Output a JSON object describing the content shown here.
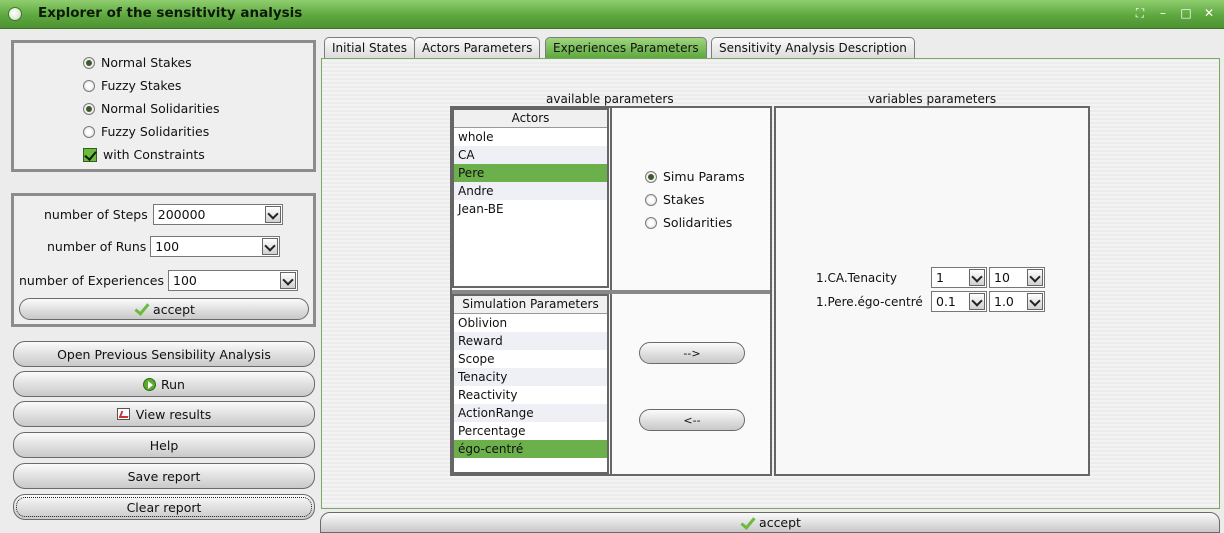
{
  "window": {
    "title": "Explorer of the sensitivity analysis",
    "controls": [
      "⛶",
      "–",
      "□",
      "✕"
    ]
  },
  "options": {
    "radios": [
      {
        "label": "Normal Stakes",
        "selected": true
      },
      {
        "label": "Fuzzy Stakes",
        "selected": false
      },
      {
        "label": "Normal Solidarities",
        "selected": true
      },
      {
        "label": "Fuzzy Solidarities",
        "selected": false
      }
    ],
    "constraints_label": "with Constraints"
  },
  "settings": {
    "steps_label": "number of Steps",
    "steps_value": "200000",
    "runs_label": "number of Runs",
    "runs_value": "100",
    "experiences_label": "number of Experiences",
    "experiences_value": "100",
    "accept_label": "accept"
  },
  "actions": {
    "open_previous": "Open Previous Sensibility Analysis",
    "run": "Run",
    "view_results": "View results",
    "help": "Help",
    "save_report": "Save report",
    "clear_report": "Clear report"
  },
  "tabs": [
    {
      "label": "Initial States",
      "active": false
    },
    {
      "label": "Actors Parameters",
      "active": false
    },
    {
      "label": "Experiences Parameters",
      "active": true
    },
    {
      "label": "Sensitivity Analysis Description",
      "active": false
    }
  ],
  "experiences": {
    "available_title": "available parameters",
    "variables_title": "variables parameters",
    "actors_header": "Actors",
    "actors": [
      {
        "label": "whole",
        "selected": false
      },
      {
        "label": "CA",
        "selected": false
      },
      {
        "label": "Pere",
        "selected": true
      },
      {
        "label": "Andre",
        "selected": false
      },
      {
        "label": "Jean-BE",
        "selected": false
      }
    ],
    "param_types": [
      {
        "label": "Simu Params",
        "selected": true
      },
      {
        "label": "Stakes",
        "selected": false
      },
      {
        "label": "Solidarities",
        "selected": false
      }
    ],
    "sim_header": "Simulation Parameters",
    "sim_params": [
      {
        "label": "Oblivion",
        "selected": false
      },
      {
        "label": "Reward",
        "selected": false
      },
      {
        "label": "Scope",
        "selected": false
      },
      {
        "label": "Tenacity",
        "selected": false
      },
      {
        "label": "Reactivity",
        "selected": false
      },
      {
        "label": "ActionRange",
        "selected": false
      },
      {
        "label": "Percentage",
        "selected": false
      },
      {
        "label": "égo-centré",
        "selected": true
      }
    ],
    "add_button": "-->",
    "remove_button": "<--",
    "variables": [
      {
        "label": "1.CA.Tenacity",
        "min": "1",
        "max": "10"
      },
      {
        "label": "1.Pere.égo-centré",
        "min": "0.1",
        "max": "1.0"
      }
    ],
    "accept_label": "accept"
  }
}
